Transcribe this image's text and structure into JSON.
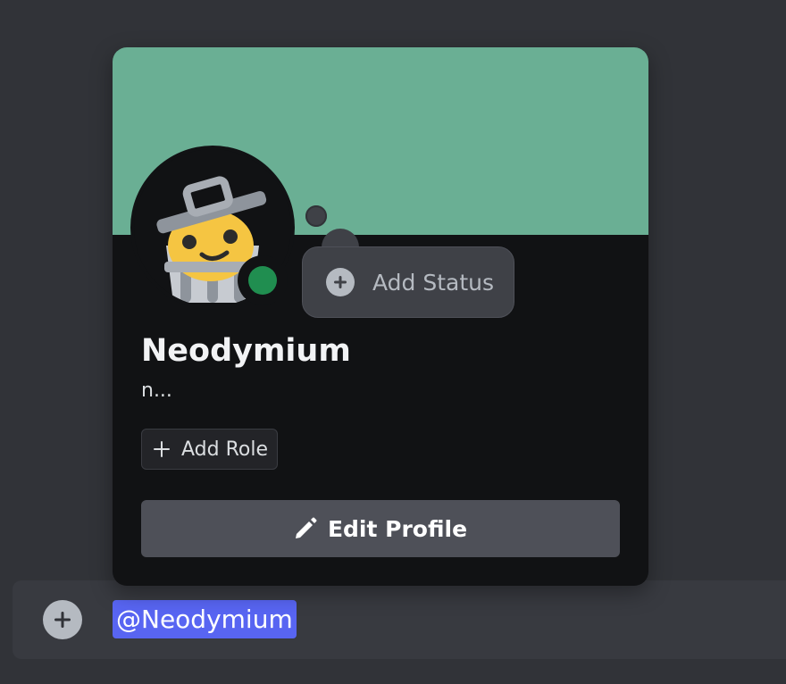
{
  "profile": {
    "display_name": "Neodymium",
    "username": "n...",
    "presence": "online",
    "banner_color": "#6aaf94",
    "avatar_icon": "trash-can-mascot-icon"
  },
  "status": {
    "add_status_label": "Add Status",
    "icon": "plus-circle-icon"
  },
  "roles": {
    "add_role_label": "Add Role",
    "icon": "plus-icon"
  },
  "actions": {
    "edit_profile_label": "Edit Profile",
    "icon": "pencil-icon"
  },
  "composer": {
    "mention_text": "@Neodymium",
    "add_icon": "plus-circle-icon"
  },
  "colors": {
    "background": "#313338",
    "card": "#111214",
    "online": "#23a55a",
    "mention": "#5865f2",
    "button": "#4e5058"
  }
}
